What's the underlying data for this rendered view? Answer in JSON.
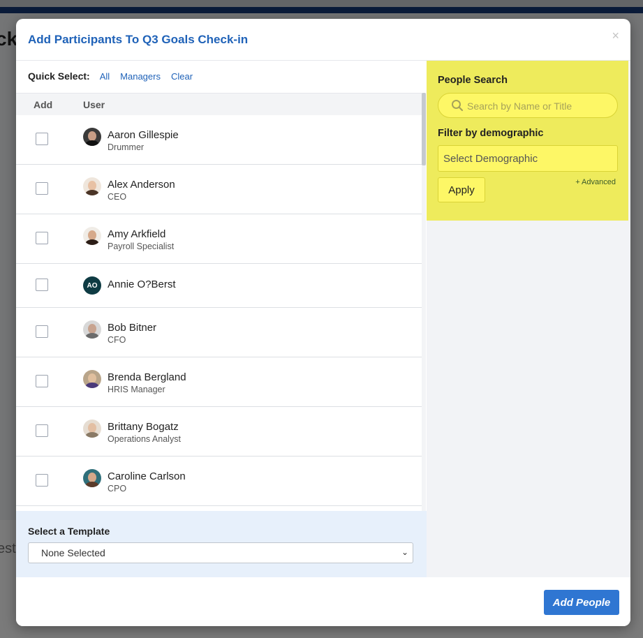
{
  "background": {
    "title_fragment": "ck",
    "card_fragment": "est"
  },
  "modal": {
    "title": "Add Participants To Q3 Goals Check-in",
    "close": "×"
  },
  "quick_select": {
    "label": "Quick Select:",
    "options": [
      "All",
      "Managers",
      "Clear"
    ]
  },
  "table": {
    "headers": {
      "add": "Add",
      "user": "User"
    },
    "rows": [
      {
        "name": "Aaron Gillespie",
        "title": "Drummer",
        "avatar": "photo",
        "checked": false
      },
      {
        "name": "Alex Anderson",
        "title": "CEO",
        "avatar": "photo",
        "checked": false
      },
      {
        "name": "Amy Arkfield",
        "title": "Payroll Specialist",
        "avatar": "photo",
        "checked": false
      },
      {
        "name": "Annie O?Berst",
        "title": "",
        "avatar": "AO",
        "checked": false
      },
      {
        "name": "Bob Bitner",
        "title": "CFO",
        "avatar": "photo",
        "checked": false
      },
      {
        "name": "Brenda Bergland",
        "title": "HRIS Manager",
        "avatar": "photo",
        "checked": false
      },
      {
        "name": "Brittany Bogatz",
        "title": "Operations Analyst",
        "avatar": "photo",
        "checked": false
      },
      {
        "name": "Caroline Carlson",
        "title": "CPO",
        "avatar": "photo",
        "checked": false
      }
    ]
  },
  "template": {
    "label": "Select a Template",
    "selected": "None Selected"
  },
  "people_search": {
    "label": "People Search",
    "placeholder": "Search by Name or Title",
    "filter_label": "Filter by demographic",
    "demographic_placeholder": "Select Demographic",
    "apply": "Apply",
    "advanced": "+ Advanced"
  },
  "footer": {
    "add_people": "Add People"
  },
  "colors": {
    "accent": "#1f62b8",
    "button": "#2f76d2",
    "highlight": "#eeeb5c"
  }
}
